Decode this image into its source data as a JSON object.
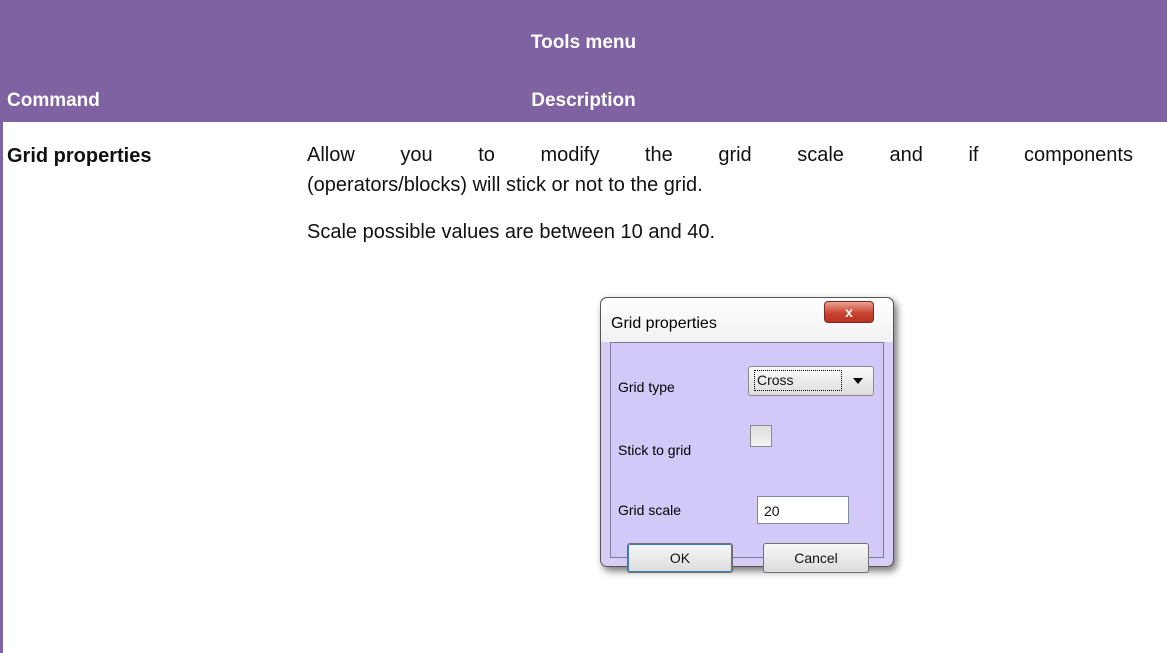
{
  "table": {
    "title": "Tools menu",
    "col_command": "Command",
    "col_description": "Description",
    "row": {
      "command": "Grid properties",
      "desc_line1": "Allow you to modify the grid scale and if components",
      "desc_line2": "(operators/blocks) will stick or not to the grid.",
      "desc_para2": "Scale possible values are between 10 and 40."
    }
  },
  "dialog": {
    "title": "Grid properties",
    "close_label": "x",
    "grid_type_label": "Grid type",
    "grid_type_value": "Cross",
    "stick_label": "Stick to grid",
    "stick_checked": false,
    "scale_label": "Grid scale",
    "scale_value": "20",
    "ok_label": "OK",
    "cancel_label": "Cancel"
  },
  "colors": {
    "header_bg": "#7f62a1",
    "dialog_bg": "#d8cdf6",
    "close_button": "#c84432"
  }
}
